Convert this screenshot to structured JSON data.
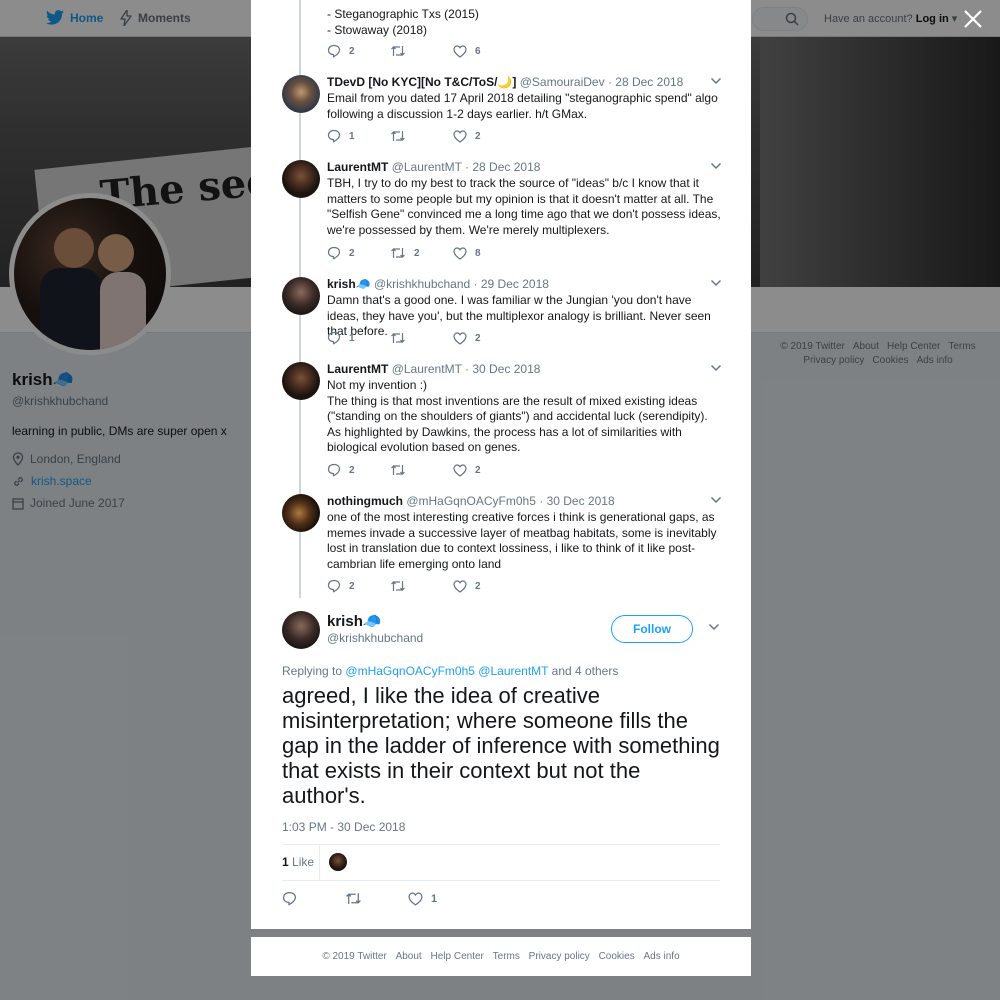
{
  "nav": {
    "home": "Home",
    "moments": "Moments",
    "have_account": "Have an account?",
    "login": "Log in"
  },
  "banner": {
    "sign_text": "The sec"
  },
  "profile": {
    "name": "krish🧢",
    "handle": "@krishkhubchand",
    "bio": "learning in public, DMs are super open x",
    "location": "London, England",
    "website": "krish.space",
    "joined": "Joined June 2017"
  },
  "right_footer": [
    "© 2019 Twitter",
    "About",
    "Help Center",
    "Terms",
    "Privacy policy",
    "Cookies",
    "Ads info"
  ],
  "thread_prefix": {
    "line1": "- Steganographic Txs (2015)",
    "line2": "- Stowaway (2018)",
    "replies": "2",
    "retweets": "",
    "likes": "6"
  },
  "tweets": [
    {
      "name": "TDevD [No KYC][No T&C/ToS/🌙]",
      "handle": "@SamouraiDev",
      "date": "· 28 Dec 2018",
      "text": "Email from you dated 17 April 2018 detailing \"steganographic spend\" algo following a discussion 1-2 days earlier. h/t GMax.",
      "replies": "1",
      "retweets": "",
      "likes": "2"
    },
    {
      "name": "LaurentMT",
      "handle": "@LaurentMT",
      "date": "· 28 Dec 2018",
      "text": "TBH, I try to do my best to track the source of \"ideas\" b/c I know that it matters to some people but my opinion is that it doesn't matter at all. The \"Selfish Gene\" convinced me a long time ago that we don't possess ideas, we're possessed by them. We're merely multiplexers.",
      "replies": "2",
      "retweets": "2",
      "likes": "8"
    },
    {
      "name": "krish🧢",
      "handle": "@krishkhubchand",
      "date": "· 29 Dec 2018",
      "text": "Damn that's a good one. I was familiar w the Jungian 'you don't have ideas, they have you', but the multiplexor analogy is brilliant. Never seen that before.",
      "replies": "1",
      "retweets": "",
      "likes": "2"
    },
    {
      "name": "LaurentMT",
      "handle": "@LaurentMT",
      "date": "· 30 Dec 2018",
      "text": "Not my invention :)\nThe thing is that most inventions are the result of mixed existing ideas (\"standing on the shoulders of giants\") and accidental luck (serendipity). As highlighted by Dawkins, the process has a lot of similarities with biological evolution based on genes.",
      "replies": "2",
      "retweets": "",
      "likes": "2"
    },
    {
      "name": "nothingmuch",
      "handle": "@mHaGqnOACyFm0h5",
      "date": "· 30 Dec 2018",
      "text": "one of the most interesting creative forces i think is generational gaps, as memes invade a successive layer of meatbag habitats, some is inevitably lost in translation due to context lossiness, i like to think of it like post-cambrian life emerging onto land",
      "replies": "2",
      "retweets": "",
      "likes": "2"
    }
  ],
  "main_tweet": {
    "name": "krish🧢",
    "handle": "@krishkhubchand",
    "follow": "Follow",
    "replying_prefix": "Replying to",
    "mention1": "@mHaGqnOACyFm0h5",
    "mention2": "@LaurentMT",
    "replying_suffix": "and 4 others",
    "text": "agreed, I like the idea of creative misinterpretation; where someone fills the gap in the ladder of inference with something that exists in their context but not the author's.",
    "time": "1:03 PM - 30 Dec 2018",
    "like_count": "1",
    "like_label": "Like",
    "likes": "1"
  },
  "modal_footer": [
    "© 2019 Twitter",
    "About",
    "Help Center",
    "Terms",
    "Privacy policy",
    "Cookies",
    "Ads info"
  ],
  "colors": {
    "brand": "#1da1f2",
    "muted": "#657786",
    "text": "#14171a"
  }
}
